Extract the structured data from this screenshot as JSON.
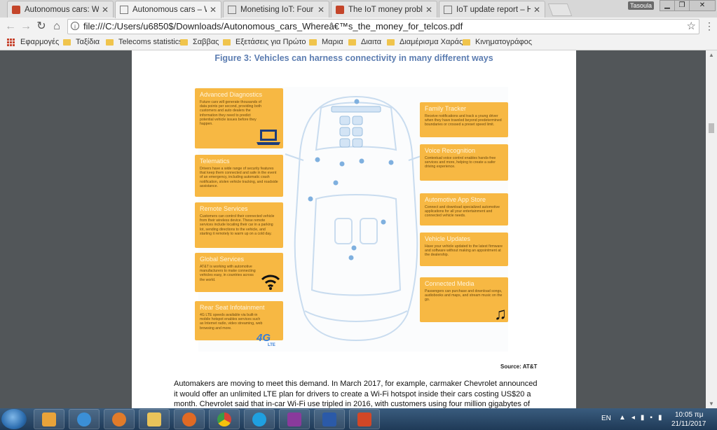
{
  "tabs": [
    {
      "title": "Autonomous cars: Where",
      "active": false,
      "favicon_color": "#c4452a"
    },
    {
      "title": "Autonomous cars – Whe",
      "active": true,
      "favicon_color": "#888888"
    },
    {
      "title": "Monetising IoT: Four ste",
      "active": false,
      "favicon_color": "#888888"
    },
    {
      "title": "The IoT money problem:",
      "active": false,
      "favicon_color": "#c4452a"
    },
    {
      "title": "IoT update report – How",
      "active": false,
      "favicon_color": "#888888"
    }
  ],
  "window": {
    "user_badge": "Tasoula"
  },
  "address_bar": {
    "url": "file:///C:/Users/u6850$/Downloads/Autonomous_cars_Whereâ€™s_the_money_for_telcos.pdf"
  },
  "bookmarks": [
    "Εφαρμογές",
    "Ταξίδια",
    "Telecoms statistics",
    "Σαββας",
    "Εξετάσεις για Πρώτο",
    "Μαρια",
    "Διαιτα",
    "Διαμέρισμα Χαράς",
    "Κινηματογράφος"
  ],
  "pdf": {
    "figure_title": "Figure 3: Vehicles can harness connectivity in many different ways",
    "cards_left": [
      {
        "title": "Advanced Diagnostics",
        "body": "Future cars will generate thousands of data points per second, providing both customers and auto dealers the information they need to predict potential vehicle issues before they happen."
      },
      {
        "title": "Telematics",
        "body": "Drivers have a wide range of security features that keep them connected and safe in the event of an emergency, including automatic crash notification, stolen vehicle tracking, and roadside assistance."
      },
      {
        "title": "Remote Services",
        "body": "Customers can control their connected vehicle from their wireless device. These remote services include locating their car in a parking lot, sending directions to the vehicle, and starting it remotely to warm up on a cold day."
      },
      {
        "title": "Global Services",
        "body": "AT&T is working with automotive manufacturers to make connecting vehicles easy, in countries across the world."
      },
      {
        "title": "Rear Seat Infotainment",
        "body": "4G LTE speeds available via built-in mobile hotspot enables services such as Internet radio, video streaming, web browsing and more."
      }
    ],
    "cards_right": [
      {
        "title": "Family Tracker",
        "body": "Receive notifications and track a young driver when they have traveled beyond predetermined boundaries or crossed a preset speed limit."
      },
      {
        "title": "Voice Recognition",
        "body": "Contextual voice control enables hands-free services and more, helping to create a safer driving experience."
      },
      {
        "title": "Automotive App Store",
        "body": "Connect and download specialized automotive applications for all your entertainment and connected vehicle needs."
      },
      {
        "title": "Vehicle Updates",
        "body": "Have your vehicle updated to the latest firmware and software without making an appointment at the dealership."
      },
      {
        "title": "Connected Media",
        "body": "Passengers can purchase and download songs, audiobooks and maps, and stream music on the go."
      }
    ],
    "badge_4g": "4G",
    "badge_lte": "LTE",
    "source": "Source: AT&T",
    "body_text": "Automakers are moving to meet this demand. In March 2017, for example, carmaker Chevrolet announced it would offer an unlimited LTE plan for drivers to create a Wi-Fi hotspot inside their cars costing US$20 a month. Chevrolet said that in-car Wi-Fi use tripled in 2016, with customers using four million gigabytes of"
  },
  "taskbar": {
    "apps": [
      {
        "name": "outlook-app",
        "color": "#e8a33a"
      },
      {
        "name": "internet-explorer-app",
        "color": "#3b8fd6"
      },
      {
        "name": "media-player-app",
        "color": "#e07b2a"
      },
      {
        "name": "file-explorer-app",
        "color": "#e9c35a"
      },
      {
        "name": "firefox-app",
        "color": "#e06a24"
      },
      {
        "name": "chrome-app",
        "color": "#3a9a48"
      },
      {
        "name": "skype-app",
        "color": "#1fa0e0"
      },
      {
        "name": "onenote-app",
        "color": "#8a3a9c"
      },
      {
        "name": "word-app",
        "color": "#2b5aa8"
      },
      {
        "name": "powerpoint-app",
        "color": "#d24726"
      }
    ],
    "language": "EN",
    "time": "10:05 πμ",
    "date": "21/11/2017"
  }
}
